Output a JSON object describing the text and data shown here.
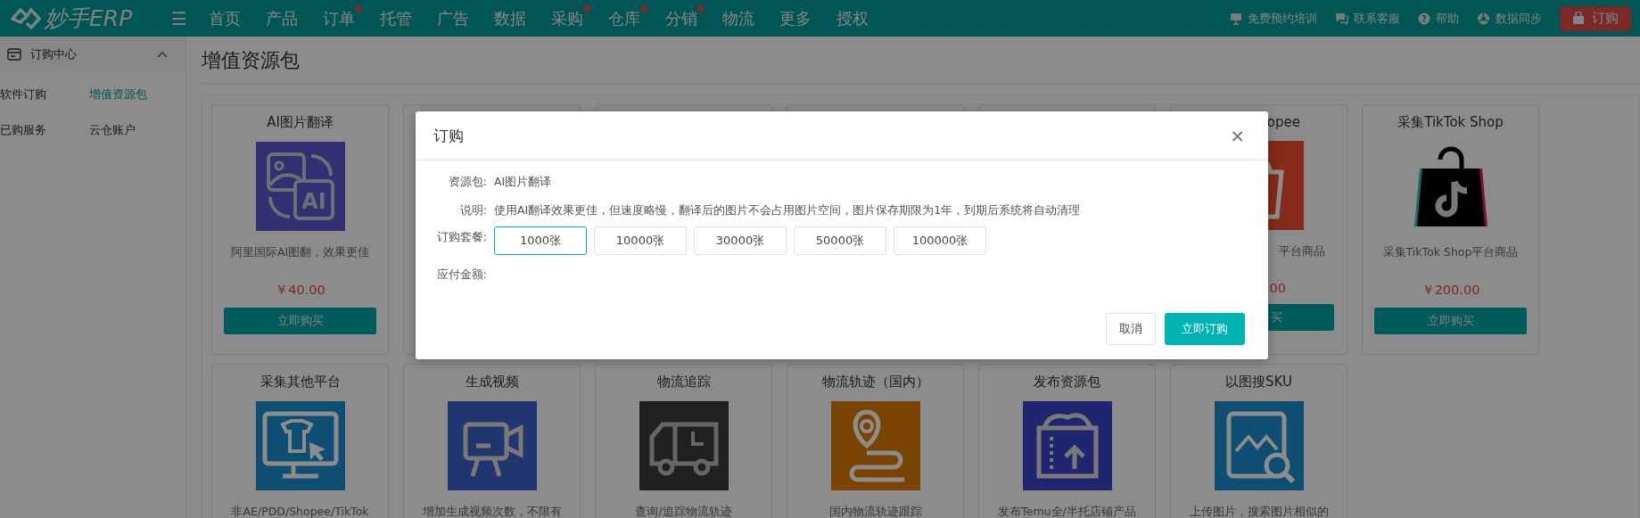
{
  "topbar": {
    "logo": "妙手ERP",
    "menu_icon": "☰",
    "nav": [
      {
        "label": "首页",
        "dot": false
      },
      {
        "label": "产品",
        "dot": false
      },
      {
        "label": "订单",
        "dot": true
      },
      {
        "label": "托管",
        "dot": false
      },
      {
        "label": "广告",
        "dot": false
      },
      {
        "label": "数据",
        "dot": false
      },
      {
        "label": "采购",
        "dot": true
      },
      {
        "label": "仓库",
        "dot": true
      },
      {
        "label": "分销",
        "dot": true
      },
      {
        "label": "物流",
        "dot": false
      },
      {
        "label": "更多",
        "dot": false
      },
      {
        "label": "授权",
        "dot": false
      }
    ],
    "links": [
      {
        "kind": "training",
        "label": "免费预约培训"
      },
      {
        "kind": "service",
        "label": "联系客服"
      },
      {
        "kind": "help",
        "label": "帮助",
        "icon_text": "?"
      },
      {
        "kind": "sync",
        "label": "数据同步"
      }
    ],
    "order_button": "订购"
  },
  "sidebar": {
    "title": "订购中心",
    "expanded": true,
    "items": [
      {
        "label": "软件订购",
        "selected": false
      },
      {
        "label": "增值资源包",
        "selected": true
      },
      {
        "label": "已购服务",
        "selected": false
      },
      {
        "label": "云仓账户",
        "selected": false
      }
    ]
  },
  "page_title": "增值资源包",
  "cards": [
    {
      "kind": "full",
      "icon_text": "AI",
      "title": "AI图片翻译",
      "description": "阿里国际AI图翻，效果更佳",
      "price": "￥40.00",
      "button": "立即购买"
    },
    {
      "kind": "covered"
    },
    {
      "kind": "covered"
    },
    {
      "kind": "covered"
    },
    {
      "kind": "covered"
    },
    {
      "kind": "partial",
      "title": "opee",
      "description": "平台商品",
      "price": "00",
      "button": "买"
    },
    {
      "kind": "full",
      "title": "采集TikTok Shop",
      "description": "采集TikTok Shop平台商品",
      "price": "￥200.00",
      "button": "立即购买"
    },
    {
      "kind": "cut",
      "title": "采集其他平台",
      "description": "非AE/PDD/Shopee/TikTok"
    },
    {
      "kind": "cut",
      "title": "生成视频",
      "description": "增加生成视频次数，不限有"
    },
    {
      "kind": "cut",
      "title": "物流追踪",
      "description": "查询/追踪物流轨迹"
    },
    {
      "kind": "cut",
      "title": "物流轨迹（国内）",
      "description": "国内物流轨迹跟踪"
    },
    {
      "kind": "cut",
      "title": "发布资源包",
      "description": "发布Temu全/半托店铺产品"
    },
    {
      "kind": "cut",
      "title": "以图搜SKU",
      "description": "上传图片，搜索图片相似的"
    }
  ],
  "dialog": {
    "title": "订购",
    "close": "×",
    "package_label": "资源包:",
    "package": "AI图片翻译",
    "note_label": "说明:",
    "note": "使用AI翻译效果更佳，但速度略慢，翻译后的图片不会占用图片空间，图片保存期限为1年，到期后系统将自动清理",
    "plan_label": "订购套餐:",
    "plans": [
      {
        "label": "1000张",
        "selected": true
      },
      {
        "label": "10000张",
        "selected": false
      },
      {
        "label": "30000张",
        "selected": false
      },
      {
        "label": "50000张",
        "selected": false
      },
      {
        "label": "100000张",
        "selected": false
      }
    ],
    "amount_label": "应付金额:",
    "buttons": [
      {
        "kind": "cancel",
        "label": "取消"
      },
      {
        "kind": "primary",
        "label": "立即订购"
      }
    ]
  }
}
